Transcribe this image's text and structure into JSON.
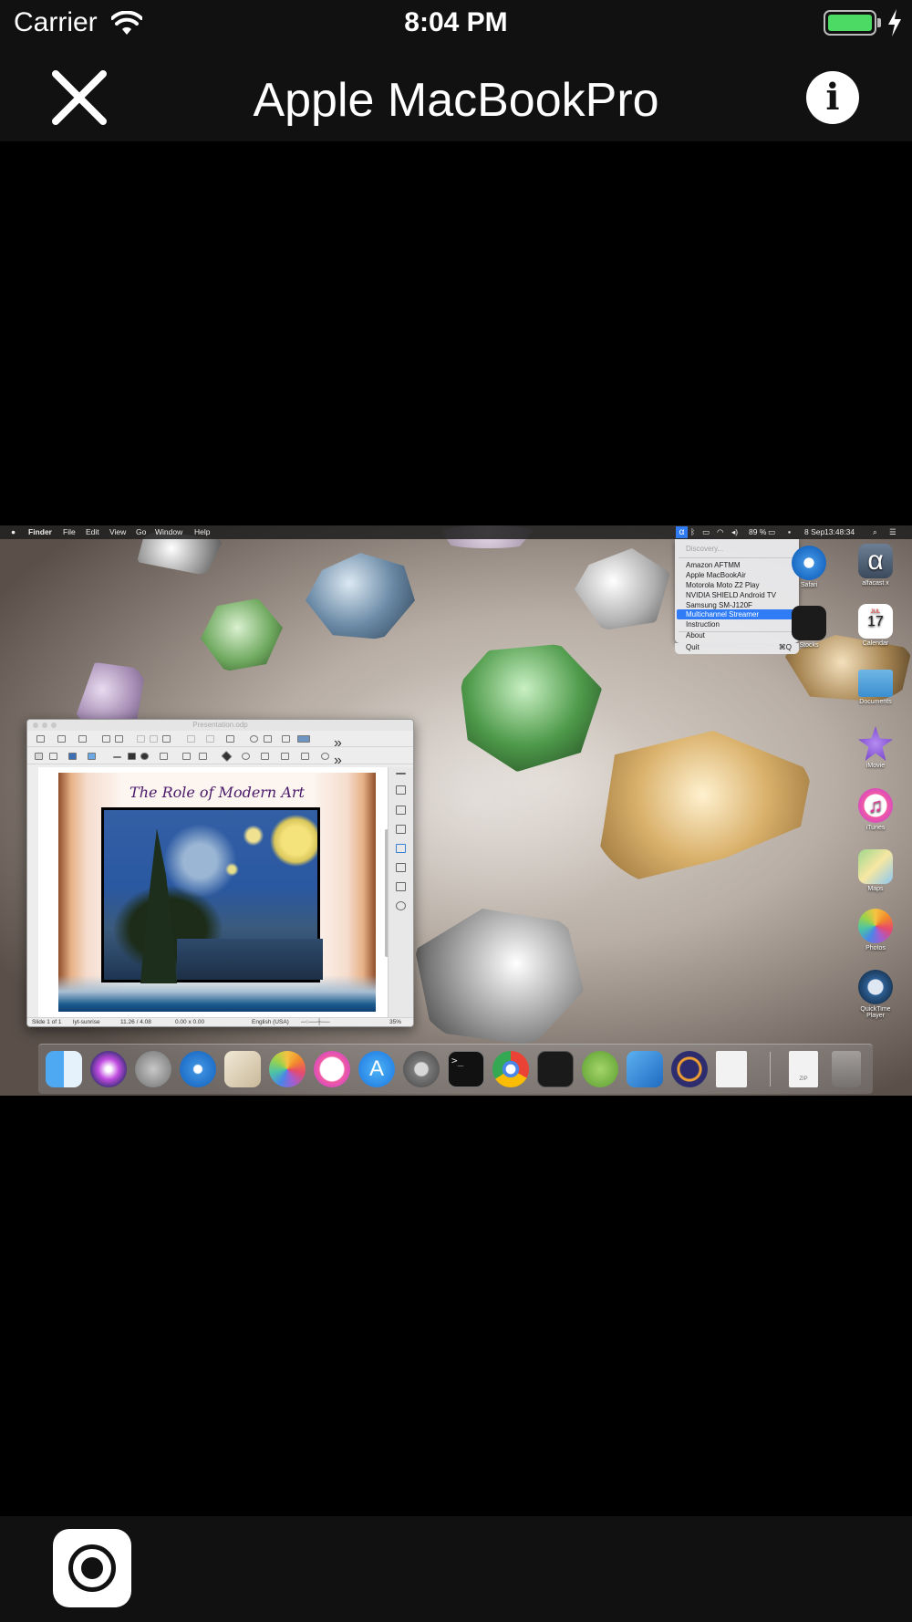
{
  "status_bar": {
    "carrier": "Carrier",
    "time": "8:04 PM",
    "icons": [
      "wifi-icon",
      "battery-icon",
      "charging-bolt-icon"
    ],
    "battery_color": "#4cd964"
  },
  "nav": {
    "title": "Apple MacBookPro",
    "close_icon": "close-icon",
    "info_label": "i"
  },
  "remote_screen": {
    "menubar": {
      "apple_icon": "apple-logo-icon",
      "app_name": "Finder",
      "menus": [
        "File",
        "Edit",
        "View",
        "Go",
        "Window",
        "Help"
      ],
      "status_alfa": "α",
      "battery": "89 %",
      "date": "8 Sep",
      "time": "13:48:34"
    },
    "dropdown": {
      "discovery": "Discovery...",
      "devices": [
        "Amazon AFTMM",
        "Apple MacBookAir",
        "Motorola Moto Z2 Play",
        "NVIDIA SHIELD Android TV",
        "Samsung SM-J120F"
      ],
      "multichannel": "Multichannel Streamer",
      "instruction": "Instruction",
      "about": "About",
      "quit": "Quit",
      "quit_shortcut": "⌘Q",
      "highlight_color": "#2f7cf6"
    },
    "desktop_icons": [
      "Safari",
      "alfacast x",
      "Stocks",
      "Calendar",
      "Documents",
      "iMovie",
      "iTunes",
      "Maps",
      "Photos",
      "QuickTime Player"
    ],
    "calendar_month": "JUL",
    "calendar_day": "17",
    "alfacast_glyph": "α",
    "libreoffice": {
      "window_title": "Presentation.odp",
      "slide_title": "The Role of Modern Art",
      "status": {
        "slide": "Slide 1 of 1",
        "layout": "lyt-sunrise",
        "position": "11.26 / 4.08",
        "size": "0.00 x 0.00",
        "language": "English (USA)",
        "zoom": "35%"
      }
    },
    "dock_apps": [
      "Finder",
      "Siri",
      "Launchpad",
      "Safari",
      "Mail",
      "Photos",
      "iTunes",
      "App Store",
      "System Preferences",
      "Terminal",
      "Chrome",
      "Activity Monitor",
      "Android Studio",
      "Xcode",
      "Eclipse",
      "Document",
      "Archive",
      "Trash"
    ],
    "dock_archive_label": "ZIP"
  },
  "bottom_bar": {
    "record_icon": "record-icon"
  }
}
